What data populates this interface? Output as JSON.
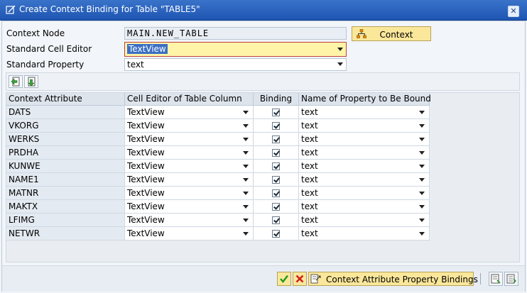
{
  "window": {
    "title": "Create Context Binding for Table \"TABLE5\""
  },
  "form": {
    "context_node_label": "Context Node",
    "context_node_value": "MAIN.NEW_TABLE",
    "standard_cell_editor_label": "Standard Cell Editor",
    "standard_cell_editor_value": "TextView",
    "standard_property_label": "Standard Property",
    "standard_property_value": "text",
    "context_button_label": "Context"
  },
  "table": {
    "columns": [
      "Context Attribute",
      "Cell Editor of Table Column",
      "Binding",
      "Name of Property to Be Bound"
    ],
    "rows": [
      {
        "attribute": "DATS",
        "editor": "TextView",
        "binding": true,
        "property": "text"
      },
      {
        "attribute": "VKORG",
        "editor": "TextView",
        "binding": true,
        "property": "text"
      },
      {
        "attribute": "WERKS",
        "editor": "TextView",
        "binding": true,
        "property": "text"
      },
      {
        "attribute": "PRDHA",
        "editor": "TextView",
        "binding": true,
        "property": "text"
      },
      {
        "attribute": "KUNWE",
        "editor": "TextView",
        "binding": true,
        "property": "text"
      },
      {
        "attribute": "NAME1",
        "editor": "TextView",
        "binding": true,
        "property": "text"
      },
      {
        "attribute": "MATNR",
        "editor": "TextView",
        "binding": true,
        "property": "text"
      },
      {
        "attribute": "MAKTX",
        "editor": "TextView",
        "binding": true,
        "property": "text"
      },
      {
        "attribute": "LFIMG",
        "editor": "TextView",
        "binding": true,
        "property": "text"
      },
      {
        "attribute": "NETWR",
        "editor": "TextView",
        "binding": true,
        "property": "text"
      }
    ]
  },
  "footer": {
    "bindings_button_label": "Context Attribute Property Bindings"
  },
  "icons": {
    "title": "edit-dialog-icon",
    "close": "close-icon",
    "context": "hierarchy-icon",
    "toolbar": [
      "insert-row-icon",
      "append-row-icon"
    ],
    "footer": [
      "confirm-check-icon",
      "cancel-x-icon",
      "bindings-icon",
      "details-icon",
      "list-icon"
    ]
  }
}
